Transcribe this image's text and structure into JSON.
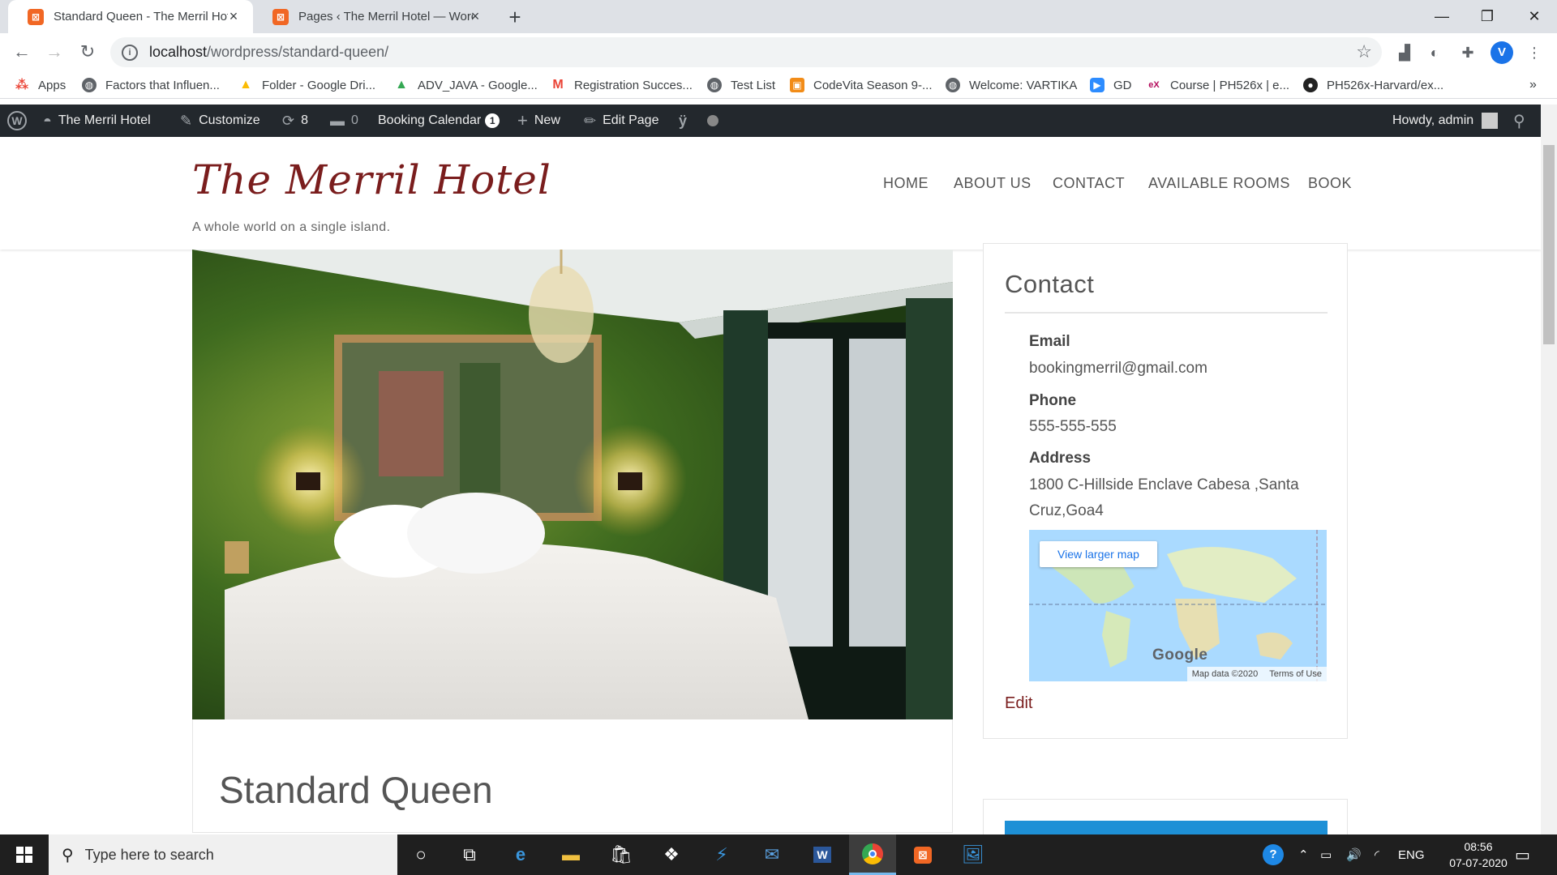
{
  "browser": {
    "tabs": [
      {
        "title": "Standard Queen - The Merril Hotel",
        "active": true
      },
      {
        "title": "Pages ‹ The Merril Hotel — WordPress",
        "active": false
      }
    ],
    "url_host": "localhost",
    "url_path": "/wordpress/standard-queen/",
    "profile_initial": "V",
    "bookmarks": [
      {
        "label": "Apps",
        "icon": "apps-grid-icon"
      },
      {
        "label": "Factors that Influen...",
        "icon": "globe-icon"
      },
      {
        "label": "Folder - Google Dri...",
        "icon": "google-drive-icon"
      },
      {
        "label": "ADV_JAVA - Google...",
        "icon": "google-drive-icon"
      },
      {
        "label": "Registration Succes...",
        "icon": "gmail-icon"
      },
      {
        "label": "Test List",
        "icon": "globe-icon"
      },
      {
        "label": "CodeVita Season 9-...",
        "icon": "codevita-icon"
      },
      {
        "label": "Welcome: VARTIKA",
        "icon": "globe-icon"
      },
      {
        "label": "GD",
        "icon": "zoom-icon"
      },
      {
        "label": "Course | PH526x | e...",
        "icon": "edx-icon"
      },
      {
        "label": "PH526x-Harvard/ex...",
        "icon": "github-icon"
      }
    ]
  },
  "adminbar": {
    "site": "The Merril Hotel",
    "customize": "Customize",
    "updates": "8",
    "comments": "0",
    "booking": "Booking Calendar",
    "booking_count": "1",
    "new": "New",
    "edit": "Edit Page",
    "howdy": "Howdy, admin"
  },
  "site": {
    "title": "The Merril Hotel",
    "tagline": "A whole world on a single island.",
    "menu": [
      "HOME",
      "ABOUT US",
      "CONTACT",
      "AVAILABLE ROOMS",
      "BOOK"
    ],
    "accent": "#7a1d1d"
  },
  "post": {
    "title": "Standard Queen"
  },
  "contact": {
    "heading": "Contact",
    "email_label": "Email",
    "email": "bookingmerril@gmail.com",
    "phone_label": "Phone",
    "phone": "555-555-555",
    "address_label": "Address",
    "address": "1800 C-Hillside Enclave Cabesa ,Santa Cruz,Goa4",
    "map_button": "View larger map",
    "map_logo": "Google",
    "map_data": "Map data ©2020",
    "map_terms": "Terms of Use",
    "edit": "Edit"
  },
  "taskbar": {
    "search_placeholder": "Type here to search",
    "lang": "ENG",
    "time": "08:56",
    "date": "07-07-2020"
  }
}
